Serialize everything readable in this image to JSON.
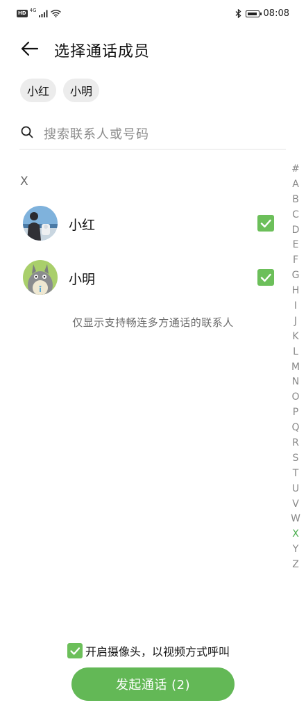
{
  "status_bar": {
    "network_badge": "HD",
    "network_type": "4G",
    "time": "08:08",
    "bluetooth_icon": "bluetooth-icon",
    "battery_level_pct": 80
  },
  "header": {
    "title": "选择通话成员",
    "back_icon": "arrow-left-icon"
  },
  "selected_chips": [
    {
      "label": "小红"
    },
    {
      "label": "小明"
    }
  ],
  "search": {
    "placeholder": "搜索联系人或号码",
    "icon": "search-icon"
  },
  "contact_list": {
    "section_letter": "X",
    "contacts": [
      {
        "name": "小红",
        "checked": true,
        "avatar": "photo-avatar"
      },
      {
        "name": "小明",
        "checked": true,
        "avatar": "totoro-avatar"
      }
    ]
  },
  "hint_text": "仅显示支持畅连多方通话的联系人",
  "index_bar": {
    "letters": [
      "#",
      "A",
      "B",
      "C",
      "D",
      "E",
      "F",
      "G",
      "H",
      "I",
      "J",
      "K",
      "L",
      "M",
      "N",
      "O",
      "P",
      "Q",
      "R",
      "S",
      "T",
      "U",
      "V",
      "W",
      "X",
      "Y",
      "Z"
    ],
    "active": "X"
  },
  "footer": {
    "camera_label": "开启摄像头，以视频方式呼叫",
    "camera_checked": true,
    "call_button_label": "发起通话 (2)"
  },
  "colors": {
    "accent_green": "#63b856",
    "checkbox_green": "#6cbf5a",
    "chip_bg": "#ececec"
  }
}
